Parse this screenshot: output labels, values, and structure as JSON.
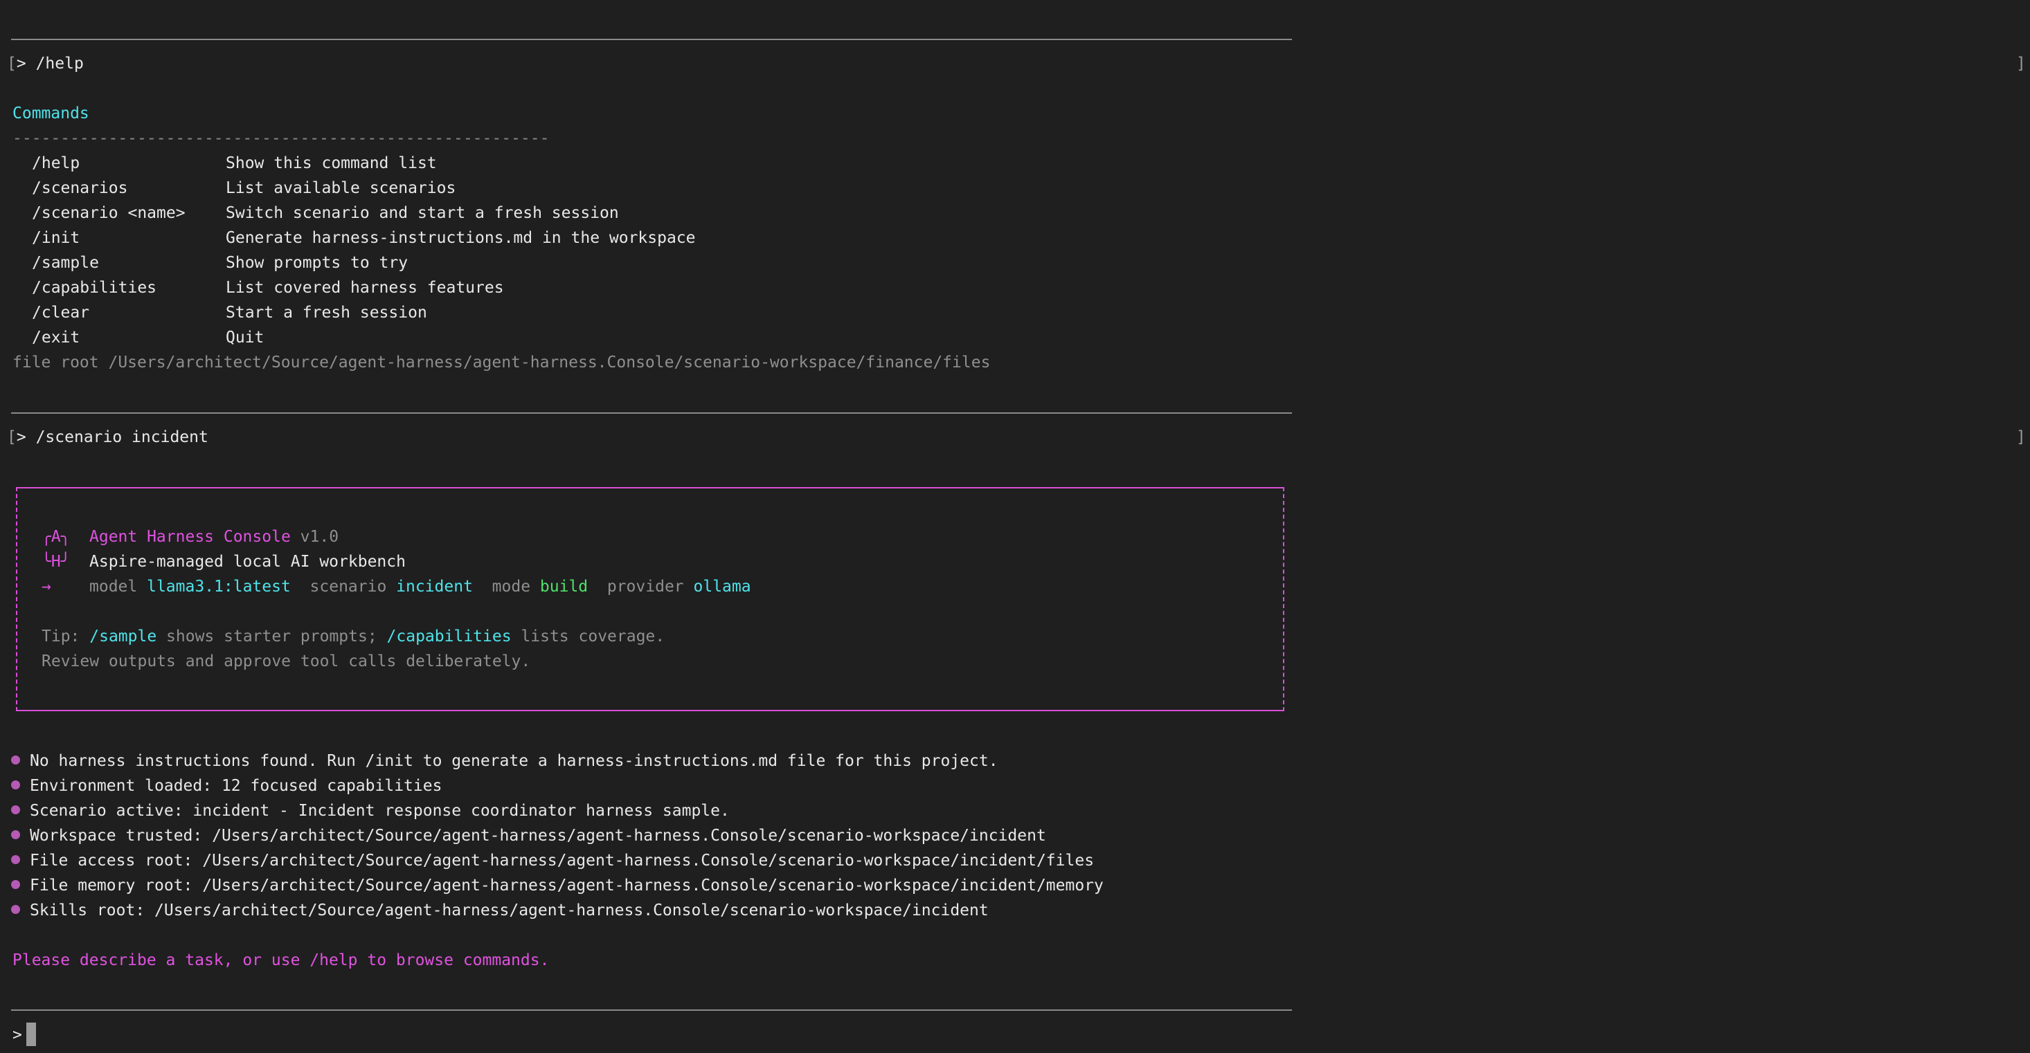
{
  "prompt_symbol": ">",
  "history": [
    {
      "command": "/help"
    },
    {
      "command": "/scenario incident"
    }
  ],
  "commands_section": {
    "title": "Commands",
    "divider": "--------------------------------------------------------",
    "items": [
      {
        "name": "/help",
        "desc": "Show this command list"
      },
      {
        "name": "/scenarios",
        "desc": "List available scenarios"
      },
      {
        "name": "/scenario <name>",
        "desc": "Switch scenario and start a fresh session"
      },
      {
        "name": "/init",
        "desc": "Generate harness-instructions.md in the workspace"
      },
      {
        "name": "/sample",
        "desc": "Show prompts to try"
      },
      {
        "name": "/capabilities",
        "desc": "List covered harness features"
      },
      {
        "name": "/clear",
        "desc": "Start a fresh session"
      },
      {
        "name": "/exit",
        "desc": "Quit"
      }
    ],
    "file_root": "file root /Users/architect/Source/agent-harness/agent-harness.Console/scenario-workspace/finance/files"
  },
  "banner": {
    "logo_top": "╭A╮",
    "logo_bottom": "╰H╯",
    "arrow": "→",
    "app_name": "Agent Harness Console",
    "version": "v1.0",
    "tagline": "Aspire-managed local AI workbench",
    "model_label": "model",
    "model_value": "llama3.1:latest",
    "scenario_label": "scenario",
    "scenario_value": "incident",
    "mode_label": "mode",
    "mode_value": "build",
    "provider_label": "provider",
    "provider_value": "ollama",
    "tip_prefix": "Tip:",
    "tip_sample": "/sample",
    "tip_mid": "shows starter prompts;",
    "tip_capabilities": "/capabilities",
    "tip_end": "lists coverage.",
    "review_line": "Review outputs and approve tool calls deliberately."
  },
  "status_lines": [
    "No harness instructions found. Run /init to generate a harness-instructions.md file for this project.",
    "Environment loaded: 12 focused capabilities",
    "Scenario active: incident - Incident response coordinator harness sample.",
    "Workspace trusted: /Users/architect/Source/agent-harness/agent-harness.Console/scenario-workspace/incident",
    "File access root: /Users/architect/Source/agent-harness/agent-harness.Console/scenario-workspace/incident/files",
    "File memory root: /Users/architect/Source/agent-harness/agent-harness.Console/scenario-workspace/incident/memory",
    "Skills root: /Users/architect/Source/agent-harness/agent-harness.Console/scenario-workspace/incident"
  ],
  "footer_message": "Please describe a task, or use /help to browse commands.",
  "input": {
    "value": ""
  },
  "colors": {
    "background": "#1f1f1f",
    "accent_cyan": "#4fe3ea",
    "accent_magenta": "#e052e0",
    "accent_green": "#4ee06a",
    "bullet": "#b55ab5"
  }
}
